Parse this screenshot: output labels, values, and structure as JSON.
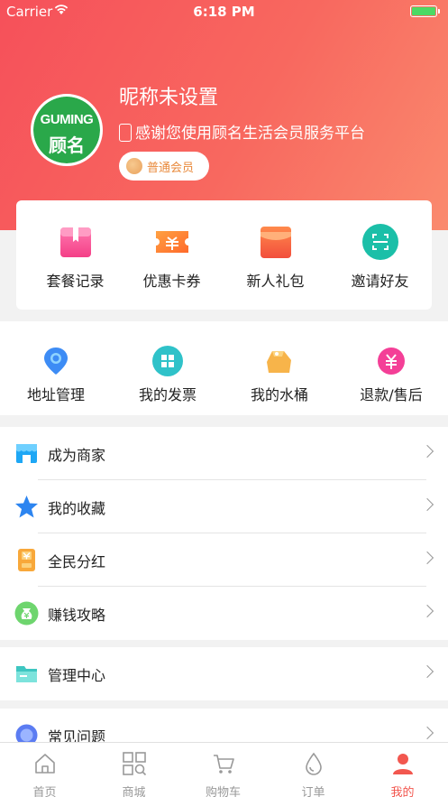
{
  "status_bar": {
    "carrier": "Carrier",
    "time": "6:18 PM"
  },
  "profile": {
    "avatar_logo_en": "GUMING",
    "avatar_logo_cn": "顾名",
    "nickname": "昵称未设置",
    "slogan": "感谢您使用顾名生活会员服务平台",
    "member_level": "普通会员"
  },
  "quick_actions": [
    {
      "label": "套餐记录",
      "icon": "package-icon"
    },
    {
      "label": "优惠卡券",
      "icon": "coupon-icon"
    },
    {
      "label": "新人礼包",
      "icon": "gift-bag-icon"
    },
    {
      "label": "邀请好友",
      "icon": "scan-icon"
    }
  ],
  "services": [
    {
      "label": "地址管理",
      "icon": "location-pin-icon"
    },
    {
      "label": "我的发票",
      "icon": "invoice-icon"
    },
    {
      "label": "我的水桶",
      "icon": "water-bucket-icon"
    },
    {
      "label": "退款/售后",
      "icon": "refund-icon"
    }
  ],
  "menu_group_1": [
    {
      "label": "成为商家",
      "icon": "store-icon"
    },
    {
      "label": "我的收藏",
      "icon": "star-icon"
    },
    {
      "label": "全民分红",
      "icon": "dividend-icon"
    },
    {
      "label": "赚钱攻略",
      "icon": "money-bag-icon"
    }
  ],
  "menu_group_2": [
    {
      "label": "管理中心",
      "icon": "folder-icon"
    }
  ],
  "menu_group_3": [
    {
      "label": "常见问题",
      "icon": "help-icon"
    }
  ],
  "tabbar": [
    {
      "label": "首页",
      "icon": "home-icon",
      "active": false
    },
    {
      "label": "商城",
      "icon": "mall-grid-icon",
      "active": false
    },
    {
      "label": "购物车",
      "icon": "cart-icon",
      "active": false
    },
    {
      "label": "订单",
      "icon": "order-drop-icon",
      "active": false
    },
    {
      "label": "我的",
      "icon": "user-icon",
      "active": true
    }
  ],
  "colors": {
    "header_gradient_start": "#f6505a",
    "header_gradient_end": "#fa8a6e",
    "active_tab": "#f2574f",
    "badge_text": "#e98a3c"
  }
}
